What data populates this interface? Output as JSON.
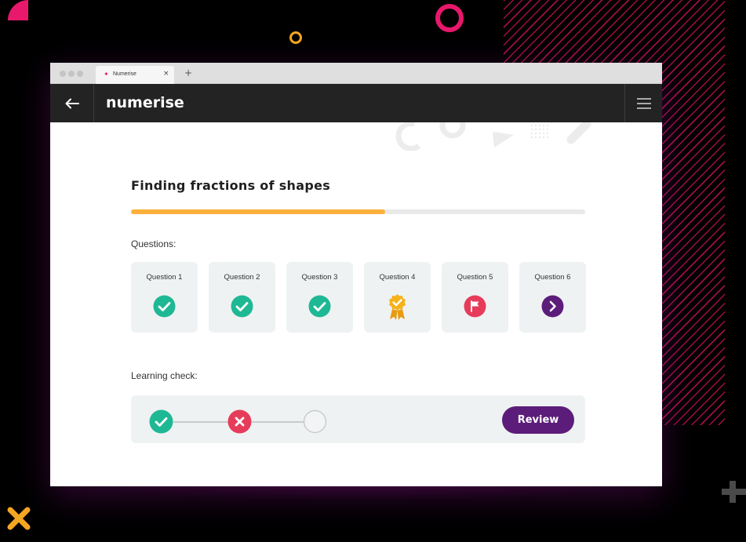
{
  "browser": {
    "tab_title": "Numerise",
    "tab_close": "×",
    "new_tab": "+"
  },
  "app": {
    "logo": "numerise",
    "back_icon": "arrow-left-icon",
    "menu_icon": "hamburger-menu-icon"
  },
  "page": {
    "title": "Finding fractions of shapes",
    "progress": 0.56,
    "questions_label": "Questions:",
    "learning_check_label": "Learning check:",
    "review_label": "Review"
  },
  "questions": [
    {
      "label": "Question 1",
      "status": "correct",
      "icon": "check-circle-icon"
    },
    {
      "label": "Question 2",
      "status": "correct",
      "icon": "check-circle-icon"
    },
    {
      "label": "Question 3",
      "status": "correct",
      "icon": "check-circle-icon"
    },
    {
      "label": "Question 4",
      "status": "award",
      "icon": "award-rosette-icon"
    },
    {
      "label": "Question 5",
      "status": "flagged",
      "icon": "flag-circle-icon"
    },
    {
      "label": "Question 6",
      "status": "next",
      "icon": "chevron-right-circle-icon"
    }
  ],
  "learning_check": [
    {
      "status": "correct",
      "icon": "check-circle-icon"
    },
    {
      "status": "incorrect",
      "icon": "cross-circle-icon"
    },
    {
      "status": "pending",
      "icon": "empty-circle-icon"
    }
  ],
  "colors": {
    "correct": "#1fb894",
    "incorrect": "#e63c5a",
    "award": "#f5b21b",
    "flag": "#e63c5a",
    "next": "#5c1d7a",
    "progress": "#fbb03b",
    "brand_pink": "#e8186c"
  }
}
